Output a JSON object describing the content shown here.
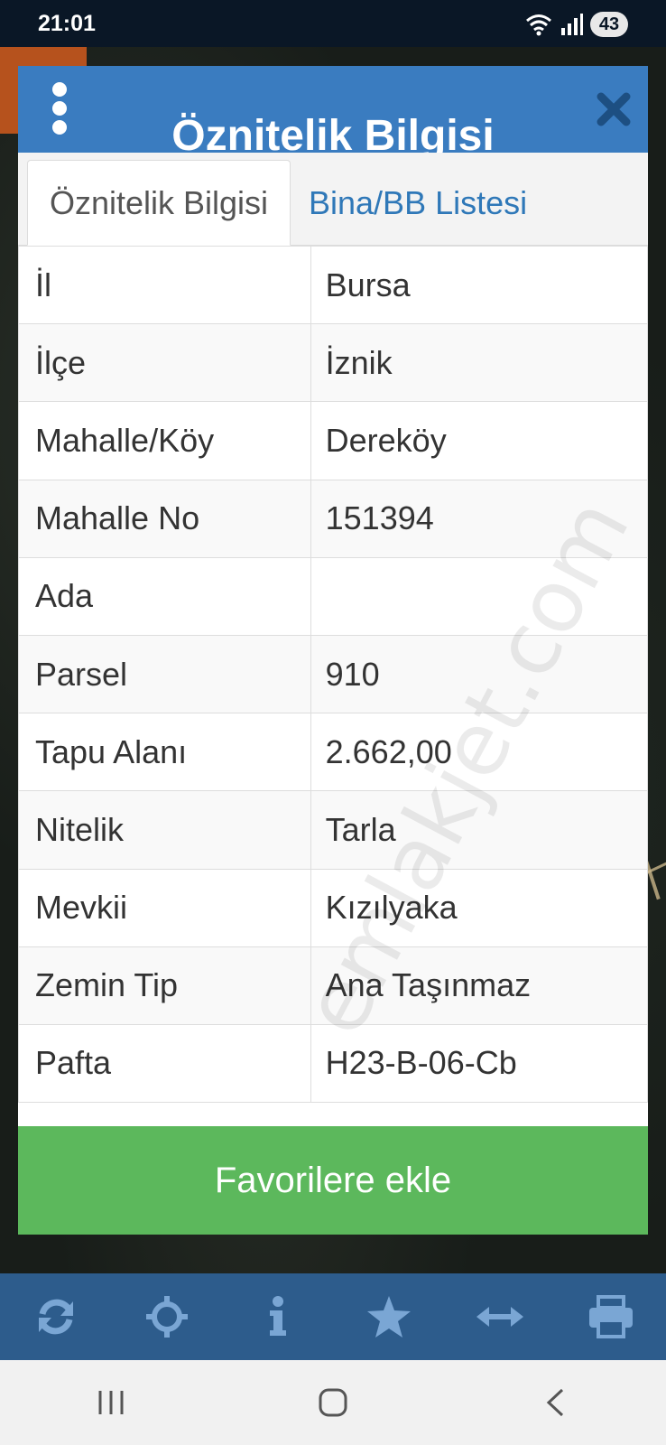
{
  "status_bar": {
    "time": "21:01",
    "battery": "43",
    "icons": [
      "wifi-5g-icon",
      "signal-icon"
    ]
  },
  "dialog": {
    "title": "Öznitelik Bilgisi",
    "header_color": "#3a7cc0",
    "menu_icon": "more-vertical-icon",
    "close_icon": "close-icon",
    "tabs": [
      {
        "label": "Öznitelik Bilgisi",
        "active": true
      },
      {
        "label": "Bina/BB Listesi",
        "active": false
      }
    ],
    "rows": [
      {
        "key": "İl",
        "value": "Bursa"
      },
      {
        "key": "İlçe",
        "value": "İznik"
      },
      {
        "key": "Mahalle/Köy",
        "value": "Dereköy"
      },
      {
        "key": "Mahalle No",
        "value": "151394"
      },
      {
        "key": "Ada",
        "value": ""
      },
      {
        "key": "Parsel",
        "value": "910"
      },
      {
        "key": "Tapu Alanı",
        "value": "2.662,00"
      },
      {
        "key": "Nitelik",
        "value": "Tarla"
      },
      {
        "key": "Mevkii",
        "value": "Kızılyaka"
      },
      {
        "key": "Zemin Tip",
        "value": "Ana Taşınmaz"
      },
      {
        "key": "Pafta",
        "value": "H23-B-06-Cb"
      }
    ],
    "favorite_button": "Favorilere ekle",
    "favorite_color": "#5cb85c"
  },
  "watermark": "emlakjet.com",
  "toolbar": {
    "color": "#2d5c8c",
    "buttons": [
      "refresh-icon",
      "crosshair-icon",
      "info-icon",
      "star-icon",
      "measure-icon",
      "print-icon"
    ]
  },
  "nav_bar": {
    "buttons": [
      "recent-apps-icon",
      "home-icon",
      "back-icon"
    ]
  }
}
